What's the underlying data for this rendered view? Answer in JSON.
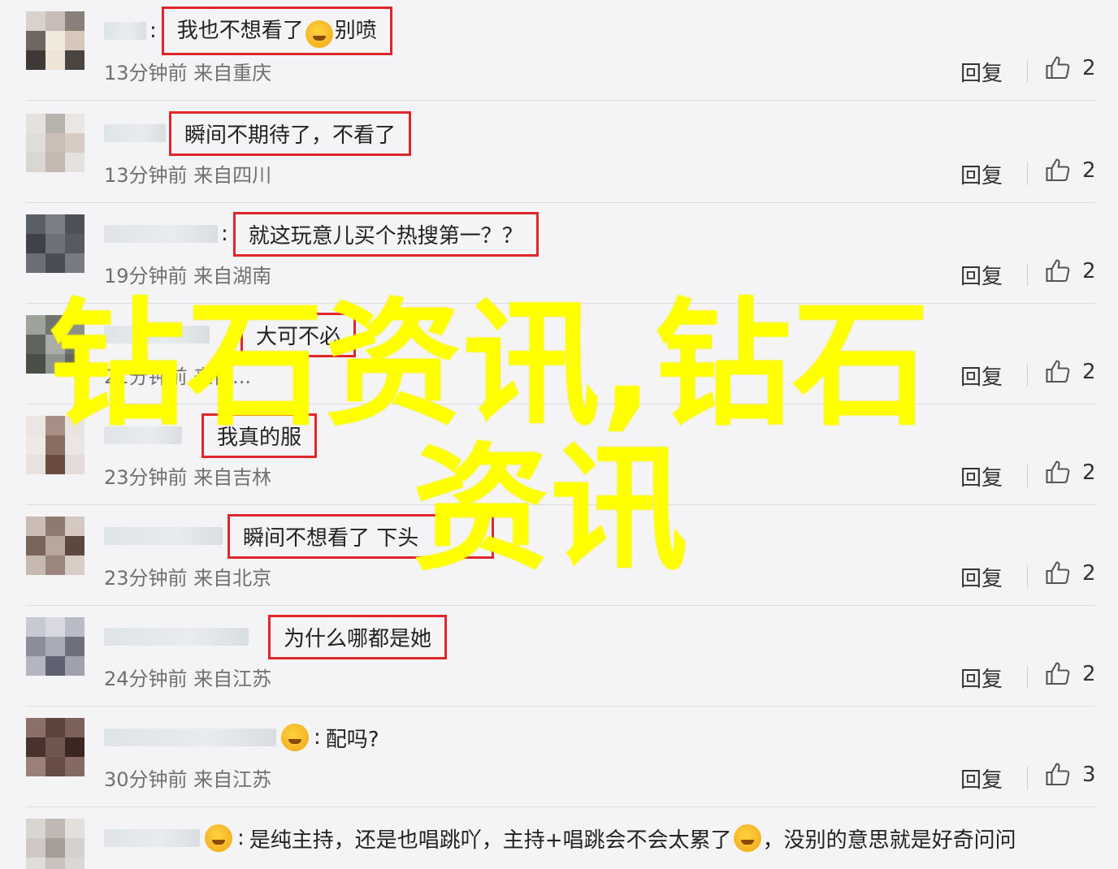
{
  "comments": [
    {
      "text": "我也不想看了",
      "text_after": "别喷",
      "boxed": true,
      "meta": "13分钟前 来自重庆",
      "reply": "回复",
      "likes": "2"
    },
    {
      "text": "瞬间不期待了，不看了",
      "boxed": true,
      "meta": "13分钟前 来自四川",
      "reply": "回复",
      "likes": "2"
    },
    {
      "text": "就这玩意儿买个热搜第一？？",
      "boxed": true,
      "meta": "19分钟前 来自湖南",
      "reply": "回复",
      "likes": "2"
    },
    {
      "text": "大可不必",
      "boxed": true,
      "meta": "21分钟前 来自...",
      "reply": "回复",
      "likes": "2"
    },
    {
      "text": "我真的服",
      "boxed": true,
      "meta": "23分钟前 来自吉林",
      "reply": "回复",
      "likes": "2"
    },
    {
      "text": "瞬间不想看了 下头",
      "boxed": true,
      "meta": "23分钟前 来自北京",
      "reply": "回复",
      "likes": "2"
    },
    {
      "text": "为什么哪都是她",
      "boxed": true,
      "meta": "24分钟前 来自江苏",
      "reply": "回复",
      "likes": "2"
    },
    {
      "text": "配吗?",
      "boxed": false,
      "meta": "30分钟前 来自江苏",
      "reply": "回复",
      "likes": "3"
    },
    {
      "text": "是纯主持，还是也唱跳吖，主持+唱跳会不会太累了",
      "text_after": "，没别的意思就是好奇问问",
      "boxed": false,
      "meta": "",
      "reply": "",
      "likes": ""
    }
  ],
  "watermark": {
    "line1": "钻石资讯,钻石",
    "line2": "资讯"
  },
  "colors": {
    "box_border": "#e0262a",
    "watermark": "#ffff00",
    "divider": "#dcdce0"
  },
  "icons": {
    "like": "thumbs-up-icon",
    "emoji": "emoji-icon"
  }
}
